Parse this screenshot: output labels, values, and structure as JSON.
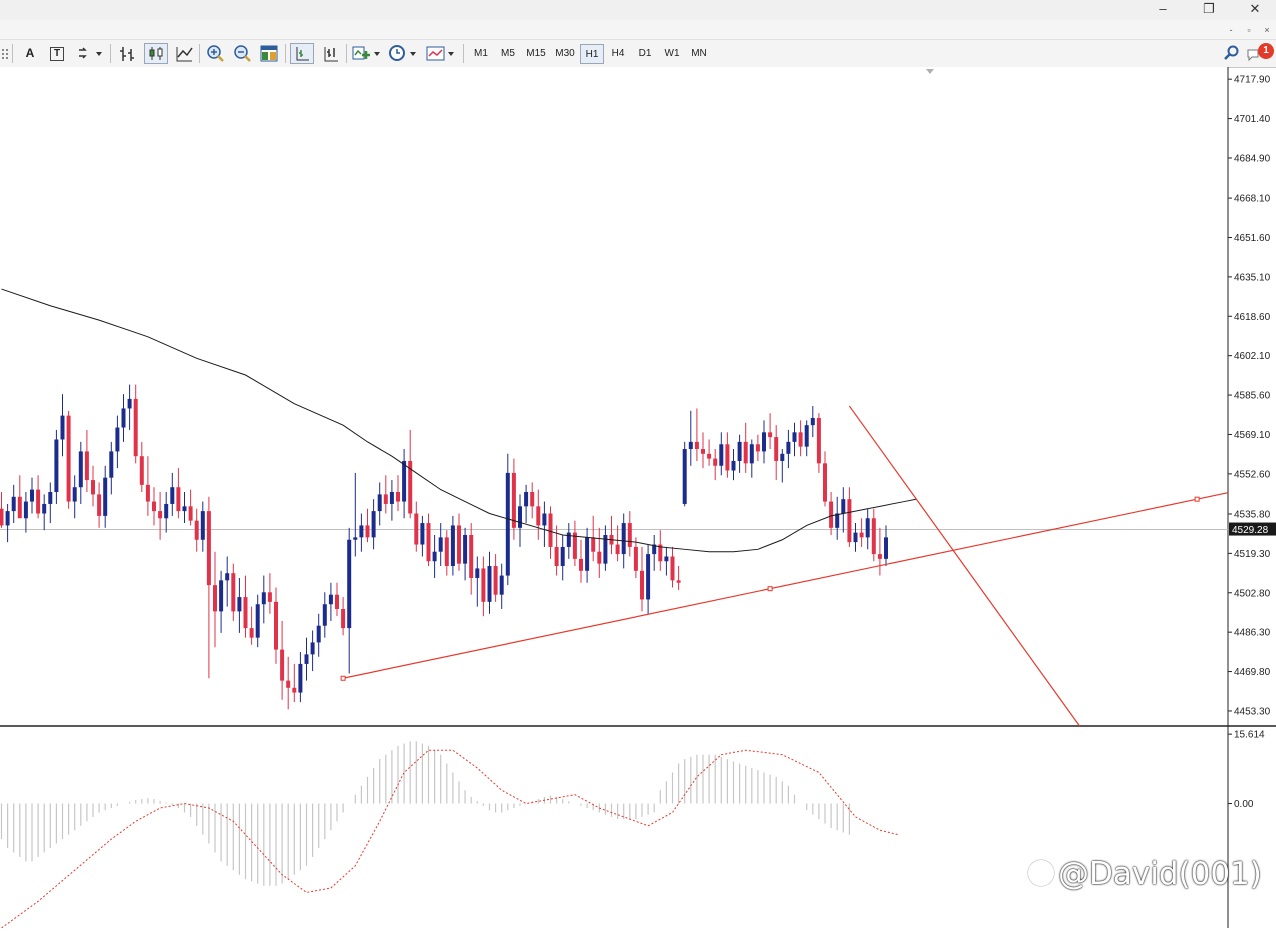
{
  "window": {
    "minimize": "–",
    "restore": "❐",
    "close": "✕"
  },
  "mdi": {
    "minimize": "-",
    "restore": "▫",
    "close": "×"
  },
  "toolbar": {
    "text_tool": "A",
    "label_tool": "T",
    "timeframes": [
      {
        "label": "M1",
        "active": false
      },
      {
        "label": "M5",
        "active": false
      },
      {
        "label": "M15",
        "active": false
      },
      {
        "label": "M30",
        "active": false
      },
      {
        "label": "H1",
        "active": true
      },
      {
        "label": "H4",
        "active": false
      },
      {
        "label": "D1",
        "active": false
      },
      {
        "label": "W1",
        "active": false
      },
      {
        "label": "MN",
        "active": false
      }
    ],
    "notification_count": "1"
  },
  "colors": {
    "bull": "#1c2c8c",
    "bear": "#e0334a",
    "ma": "#1a1a1a",
    "trendline": "#e8372c",
    "price_line": "#c0c0c0",
    "macd_hist": "#c6c6c6",
    "signal": "#e8372c"
  },
  "chart_data": [
    {
      "type": "candlestick",
      "price_axis": {
        "min": 4447.0,
        "max": 4723.0,
        "ticks": [
          "4717.90",
          "4701.40",
          "4684.90",
          "4668.10",
          "4651.60",
          "4635.10",
          "4618.60",
          "4602.10",
          "4585.60",
          "4569.10",
          "4552.60",
          "4535.80",
          "4519.30",
          "4502.80",
          "4486.30",
          "4469.80",
          "4453.30"
        ]
      },
      "current_price": "4529.28",
      "candles": [
        [
          4538,
          4545,
          4530,
          4531
        ],
        [
          4531,
          4540,
          4524,
          4537
        ],
        [
          4537,
          4548,
          4532,
          4543
        ],
        [
          4543,
          4552,
          4535,
          4534
        ],
        [
          4534,
          4545,
          4528,
          4541
        ],
        [
          4541,
          4551,
          4536,
          4546
        ],
        [
          4546,
          4552,
          4534,
          4536
        ],
        [
          4536,
          4544,
          4529,
          4540
        ],
        [
          4540,
          4549,
          4532,
          4545
        ],
        [
          4545,
          4571,
          4540,
          4567
        ],
        [
          4567,
          4586,
          4560,
          4577
        ],
        [
          4577,
          4579,
          4538,
          4541
        ],
        [
          4541,
          4552,
          4534,
          4547
        ],
        [
          4547,
          4566,
          4540,
          4562
        ],
        [
          4562,
          4571,
          4545,
          4550
        ],
        [
          4550,
          4556,
          4539,
          4544
        ],
        [
          4544,
          4549,
          4530,
          4535
        ],
        [
          4535,
          4556,
          4530,
          4551
        ],
        [
          4551,
          4566,
          4544,
          4562
        ],
        [
          4562,
          4577,
          4555,
          4572
        ],
        [
          4572,
          4586,
          4566,
          4580
        ],
        [
          4580,
          4590,
          4571,
          4584
        ],
        [
          4584,
          4590,
          4557,
          4560
        ],
        [
          4560,
          4566,
          4545,
          4548
        ],
        [
          4548,
          4560,
          4535,
          4541
        ],
        [
          4541,
          4547,
          4531,
          4537
        ],
        [
          4537,
          4545,
          4525,
          4534
        ],
        [
          4534,
          4545,
          4528,
          4540
        ],
        [
          4540,
          4553,
          4535,
          4547
        ],
        [
          4547,
          4555,
          4534,
          4537
        ],
        [
          4537,
          4545,
          4532,
          4539
        ],
        [
          4539,
          4546,
          4531,
          4533
        ],
        [
          4533,
          4538,
          4520,
          4525
        ],
        [
          4525,
          4541,
          4520,
          4537
        ],
        [
          4537,
          4543,
          4467,
          4506
        ],
        [
          4506,
          4520,
          4480,
          4495
        ],
        [
          4495,
          4512,
          4486,
          4508
        ],
        [
          4508,
          4518,
          4497,
          4511
        ],
        [
          4511,
          4515,
          4491,
          4495
        ],
        [
          4495,
          4509,
          4486,
          4501
        ],
        [
          4501,
          4510,
          4484,
          4488
        ],
        [
          4488,
          4497,
          4481,
          4484
        ],
        [
          4484,
          4502,
          4480,
          4498
        ],
        [
          4498,
          4510,
          4490,
          4503
        ],
        [
          4503,
          4511,
          4494,
          4499
        ],
        [
          4499,
          4505,
          4473,
          4479
        ],
        [
          4479,
          4491,
          4458,
          4466
        ],
        [
          4466,
          4476,
          4454,
          4463
        ],
        [
          4463,
          4473,
          4457,
          4461
        ],
        [
          4461,
          4478,
          4457,
          4473
        ],
        [
          4473,
          4484,
          4466,
          4477
        ],
        [
          4477,
          4487,
          4470,
          4482
        ],
        [
          4482,
          4494,
          4476,
          4489
        ],
        [
          4489,
          4503,
          4484,
          4498
        ],
        [
          4498,
          4507,
          4491,
          4502
        ],
        [
          4502,
          4507,
          4493,
          4496
        ],
        [
          4496,
          4501,
          4485,
          4488
        ],
        [
          4488,
          4530,
          4469,
          4525
        ],
        [
          4525,
          4553,
          4518,
          4526
        ],
        [
          4526,
          4536,
          4520,
          4531
        ],
        [
          4531,
          4538,
          4524,
          4526
        ],
        [
          4526,
          4542,
          4521,
          4537
        ],
        [
          4537,
          4549,
          4531,
          4544
        ],
        [
          4544,
          4552,
          4536,
          4540
        ],
        [
          4540,
          4550,
          4533,
          4545
        ],
        [
          4545,
          4552,
          4537,
          4541
        ],
        [
          4541,
          4563,
          4534,
          4558
        ],
        [
          4558,
          4571,
          4534,
          4536
        ],
        [
          4536,
          4541,
          4520,
          4523
        ],
        [
          4523,
          4535,
          4518,
          4532
        ],
        [
          4532,
          4536,
          4514,
          4516
        ],
        [
          4516,
          4527,
          4509,
          4520
        ],
        [
          4520,
          4532,
          4514,
          4526
        ],
        [
          4526,
          4529,
          4510,
          4514
        ],
        [
          4514,
          4535,
          4510,
          4531
        ],
        [
          4531,
          4536,
          4512,
          4515
        ],
        [
          4515,
          4530,
          4508,
          4527
        ],
        [
          4527,
          4532,
          4502,
          4509
        ],
        [
          4509,
          4518,
          4497,
          4513
        ],
        [
          4513,
          4518,
          4493,
          4499
        ],
        [
          4499,
          4520,
          4494,
          4514
        ],
        [
          4514,
          4519,
          4499,
          4502
        ],
        [
          4502,
          4515,
          4496,
          4510
        ],
        [
          4510,
          4561,
          4506,
          4553
        ],
        [
          4553,
          4559,
          4525,
          4530
        ],
        [
          4530,
          4544,
          4522,
          4539
        ],
        [
          4539,
          4548,
          4532,
          4545
        ],
        [
          4545,
          4549,
          4534,
          4539
        ],
        [
          4539,
          4546,
          4525,
          4531
        ],
        [
          4531,
          4541,
          4522,
          4536
        ],
        [
          4536,
          4539,
          4517,
          4522
        ],
        [
          4522,
          4531,
          4510,
          4514
        ],
        [
          4514,
          4527,
          4508,
          4522
        ],
        [
          4522,
          4532,
          4517,
          4528
        ],
        [
          4528,
          4533,
          4514,
          4517
        ],
        [
          4517,
          4525,
          4507,
          4512
        ],
        [
          4512,
          4530,
          4507,
          4526
        ],
        [
          4526,
          4535,
          4516,
          4520
        ],
        [
          4520,
          4530,
          4509,
          4515
        ],
        [
          4515,
          4531,
          4512,
          4527
        ],
        [
          4527,
          4535,
          4519,
          4523
        ],
        [
          4523,
          4531,
          4516,
          4519
        ],
        [
          4519,
          4536,
          4513,
          4532
        ],
        [
          4532,
          4537,
          4518,
          4522
        ],
        [
          4522,
          4526,
          4509,
          4512
        ],
        [
          4512,
          4522,
          4495,
          4500
        ],
        [
          4500,
          4523,
          4494,
          4519
        ],
        [
          4519,
          4527,
          4512,
          4523
        ],
        [
          4523,
          4529,
          4512,
          4516
        ],
        [
          4516,
          4522,
          4510,
          4518
        ],
        [
          4518,
          4522,
          4505,
          4508
        ],
        [
          4508,
          4514,
          4504,
          4507
        ],
        [
          4540,
          4566,
          4539,
          4563
        ],
        [
          4563,
          4579,
          4556,
          4566
        ],
        [
          4566,
          4580,
          4558,
          4563
        ],
        [
          4563,
          4570,
          4555,
          4561
        ],
        [
          4561,
          4567,
          4556,
          4559
        ],
        [
          4559,
          4563,
          4550,
          4556
        ],
        [
          4556,
          4570,
          4552,
          4565
        ],
        [
          4565,
          4570,
          4551,
          4554
        ],
        [
          4554,
          4563,
          4550,
          4558
        ],
        [
          4558,
          4569,
          4553,
          4566
        ],
        [
          4566,
          4574,
          4553,
          4557
        ],
        [
          4557,
          4567,
          4551,
          4565
        ],
        [
          4565,
          4569,
          4558,
          4562
        ],
        [
          4562,
          4575,
          4557,
          4570
        ],
        [
          4570,
          4578,
          4563,
          4568
        ],
        [
          4568,
          4573,
          4550,
          4558
        ],
        [
          4558,
          4563,
          4549,
          4561
        ],
        [
          4561,
          4571,
          4555,
          4566
        ],
        [
          4566,
          4574,
          4560,
          4570
        ],
        [
          4570,
          4575,
          4560,
          4564
        ],
        [
          4564,
          4575,
          4560,
          4573
        ],
        [
          4573,
          4581,
          4568,
          4576
        ],
        [
          4576,
          4578,
          4553,
          4557
        ],
        [
          4557,
          4562,
          4539,
          4541
        ],
        [
          4541,
          4545,
          4527,
          4530
        ],
        [
          4530,
          4543,
          4525,
          4536
        ],
        [
          4536,
          4547,
          4528,
          4542
        ],
        [
          4542,
          4547,
          4522,
          4524
        ],
        [
          4524,
          4532,
          4520,
          4528
        ],
        [
          4528,
          4534,
          4522,
          4526
        ],
        [
          4526,
          4538,
          4521,
          4534
        ],
        [
          4534,
          4538,
          4516,
          4519
        ],
        [
          4519,
          4530,
          4510,
          4517
        ],
        [
          4517,
          4531,
          4514,
          4526
        ]
      ],
      "moving_average": [
        [
          0,
          4630
        ],
        [
          8,
          4623
        ],
        [
          16,
          4617
        ],
        [
          24,
          4610
        ],
        [
          32,
          4601
        ],
        [
          40,
          4594
        ],
        [
          48,
          4582
        ],
        [
          56,
          4573
        ],
        [
          60,
          4566
        ],
        [
          64,
          4560
        ],
        [
          68,
          4553
        ],
        [
          72,
          4546
        ],
        [
          76,
          4541
        ],
        [
          80,
          4536
        ],
        [
          84,
          4533
        ],
        [
          88,
          4530
        ],
        [
          92,
          4527
        ],
        [
          96,
          4526
        ],
        [
          100,
          4525
        ],
        [
          104,
          4524
        ],
        [
          108,
          4522
        ],
        [
          112,
          4521
        ],
        [
          116,
          4520
        ],
        [
          120,
          4520
        ],
        [
          124,
          4521
        ],
        [
          128,
          4525
        ],
        [
          132,
          4531
        ],
        [
          136,
          4535
        ],
        [
          140,
          4537
        ],
        [
          144,
          4539
        ],
        [
          148,
          4541
        ],
        [
          150,
          4542
        ]
      ],
      "trendlines": [
        {
          "from": [
            56,
            4467
          ],
          "to": [
            196,
            4542
          ]
        },
        {
          "from": [
            139,
            4581
          ],
          "to": [
            177,
            4446
          ]
        }
      ]
    },
    {
      "type": "macd",
      "value_axis": {
        "min": -28.0,
        "max": 17.0,
        "ticks": [
          "15.614",
          "0.00"
        ]
      },
      "histogram": [
        -8,
        -10,
        -11,
        -12,
        -13,
        -13,
        -12,
        -11,
        -10,
        -9,
        -8,
        -7,
        -6,
        -5,
        -4,
        -3,
        -2,
        -1.5,
        -1,
        -0.5,
        0,
        0.4,
        0.8,
        1,
        1.2,
        1,
        0.6,
        0.2,
        -0.3,
        -1,
        -2,
        -3,
        -5,
        -7,
        -9,
        -11,
        -13,
        -14,
        -15,
        -16,
        -17,
        -17.5,
        -18,
        -18.5,
        -18.5,
        -18.5,
        -18,
        -17,
        -16,
        -15,
        -14,
        -12,
        -10,
        -8,
        -6,
        -4,
        -2,
        0,
        2,
        4,
        6,
        8,
        10,
        11,
        12,
        13,
        13.5,
        14,
        14,
        13.5,
        13,
        12,
        11,
        9,
        7,
        5,
        3,
        1.5,
        0.5,
        -0.5,
        -1.5,
        -2,
        -2,
        -1.5,
        -1,
        -0.5,
        0,
        0.5,
        1,
        1.5,
        1.8,
        1.5,
        1,
        0.5,
        0,
        -0.5,
        -1,
        -1.5,
        -2,
        -2.5,
        -3,
        -3.5,
        -3.5,
        -3.5,
        -3.5,
        -3,
        -2.5,
        -2,
        3,
        5,
        7,
        9,
        10,
        10.5,
        11,
        11,
        11,
        11,
        10.5,
        10,
        9.5,
        9,
        8.5,
        8,
        7.5,
        7,
        6.5,
        6,
        5,
        4,
        2,
        0,
        -1.5,
        -2.5,
        -3.5,
        -4.5,
        -5.5,
        -6,
        -6.5,
        -7
      ],
      "signal": [
        [
          0,
          -28
        ],
        [
          6,
          -22
        ],
        [
          12,
          -15
        ],
        [
          18,
          -8
        ],
        [
          22,
          -4
        ],
        [
          26,
          -1
        ],
        [
          30,
          0
        ],
        [
          34,
          -1
        ],
        [
          38,
          -4
        ],
        [
          42,
          -10
        ],
        [
          46,
          -16
        ],
        [
          50,
          -20
        ],
        [
          54,
          -19
        ],
        [
          58,
          -14
        ],
        [
          62,
          -4
        ],
        [
          66,
          7
        ],
        [
          70,
          12
        ],
        [
          74,
          12
        ],
        [
          78,
          8
        ],
        [
          82,
          3
        ],
        [
          86,
          0
        ],
        [
          90,
          1
        ],
        [
          94,
          2
        ],
        [
          98,
          -1
        ],
        [
          102,
          -3
        ],
        [
          106,
          -5
        ],
        [
          110,
          -2
        ],
        [
          114,
          6
        ],
        [
          118,
          11
        ],
        [
          122,
          12
        ],
        [
          128,
          11
        ],
        [
          134,
          7
        ],
        [
          140,
          -3
        ],
        [
          144,
          -6
        ],
        [
          147,
          -7
        ]
      ]
    }
  ]
}
